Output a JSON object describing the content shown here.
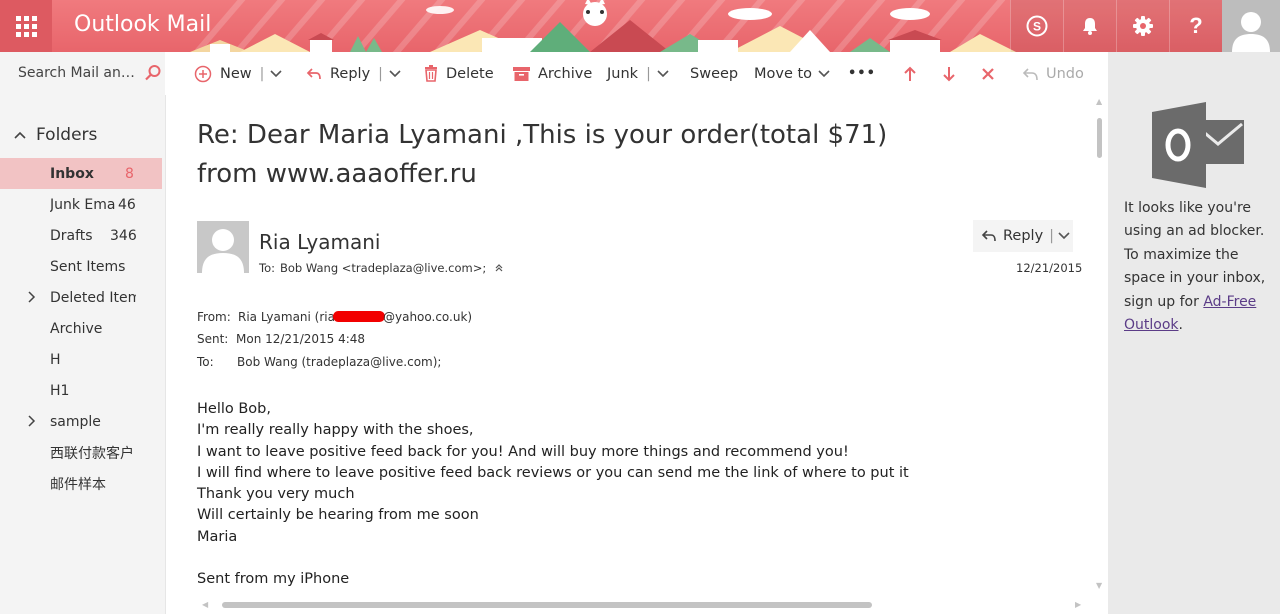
{
  "app": {
    "title": "Outlook Mail"
  },
  "header": {
    "buttons": [
      {
        "name": "skype-icon",
        "label": "S"
      },
      {
        "name": "bell-icon",
        "label": ""
      },
      {
        "name": "gear-icon",
        "label": ""
      },
      {
        "name": "help-icon",
        "label": "?"
      }
    ]
  },
  "search": {
    "placeholder": "Search Mail and People"
  },
  "toolbar": {
    "new": "New",
    "reply": "Reply",
    "delete": "Delete",
    "archive": "Archive",
    "junk": "Junk",
    "sweep": "Sweep",
    "move_to": "Move to",
    "more": "•••",
    "undo": "Undo"
  },
  "nav": {
    "folders_label": "Folders",
    "items": [
      {
        "label": "Inbox",
        "count": "8",
        "selected": true,
        "expandable": false
      },
      {
        "label": "Junk Ema",
        "count": "46",
        "selected": false,
        "expandable": false
      },
      {
        "label": "Drafts",
        "count": "346",
        "selected": false,
        "expandable": false
      },
      {
        "label": "Sent Items",
        "count": "",
        "selected": false,
        "expandable": false
      },
      {
        "label": "Deleted Items",
        "count": "",
        "selected": false,
        "expandable": true
      },
      {
        "label": "Archive",
        "count": "",
        "selected": false,
        "expandable": false
      },
      {
        "label": "H",
        "count": "",
        "selected": false,
        "expandable": false
      },
      {
        "label": "H1",
        "count": "",
        "selected": false,
        "expandable": false
      },
      {
        "label": "sample",
        "count": "",
        "selected": false,
        "expandable": true
      },
      {
        "label": "西联付款客户",
        "count": "",
        "selected": false,
        "expandable": false
      },
      {
        "label": "邮件样本",
        "count": "",
        "selected": false,
        "expandable": false
      }
    ]
  },
  "message": {
    "subject": "Re: Dear Maria Lyamani ,This is your order(total $71) from www.aaaoffer.ru",
    "sender_name": "Ria Lyamani",
    "to_prefix": "To:",
    "to_value": "Bob Wang <tradeplaza@live.com>;",
    "reply_label": "Reply",
    "date": "12/21/2015",
    "from_key": "From:",
    "from_before": "Ria Lyamani (ria",
    "from_after": "@yahoo.co.uk)",
    "sent_key": "Sent:",
    "sent_value": "Mon 12/21/2015 4:48",
    "to_key": "To:",
    "to_full": "Bob Wang (tradeplaza@live.com);",
    "body": [
      "Hello Bob,",
      "I'm really really happy with the shoes,",
      "I want to leave positive feed back for you! And will buy more things and recommend you!",
      "I will find where to leave positive feed back reviews or you can send me the link of where to put it",
      "Thank you very much",
      "Will certainly be hearing from me soon",
      "Maria",
      "",
      "Sent from my iPhone"
    ]
  },
  "ad": {
    "text": "It looks like you're using an ad blocker. To maximize the space in your inbox, sign up for",
    "link": "Ad-Free Outlook",
    "suffix": "."
  },
  "colors": {
    "brand": "#e8656b",
    "selected_folder_bg": "#f2c3c4",
    "ad_link": "#5b3c87",
    "redaction": "#f20000"
  }
}
